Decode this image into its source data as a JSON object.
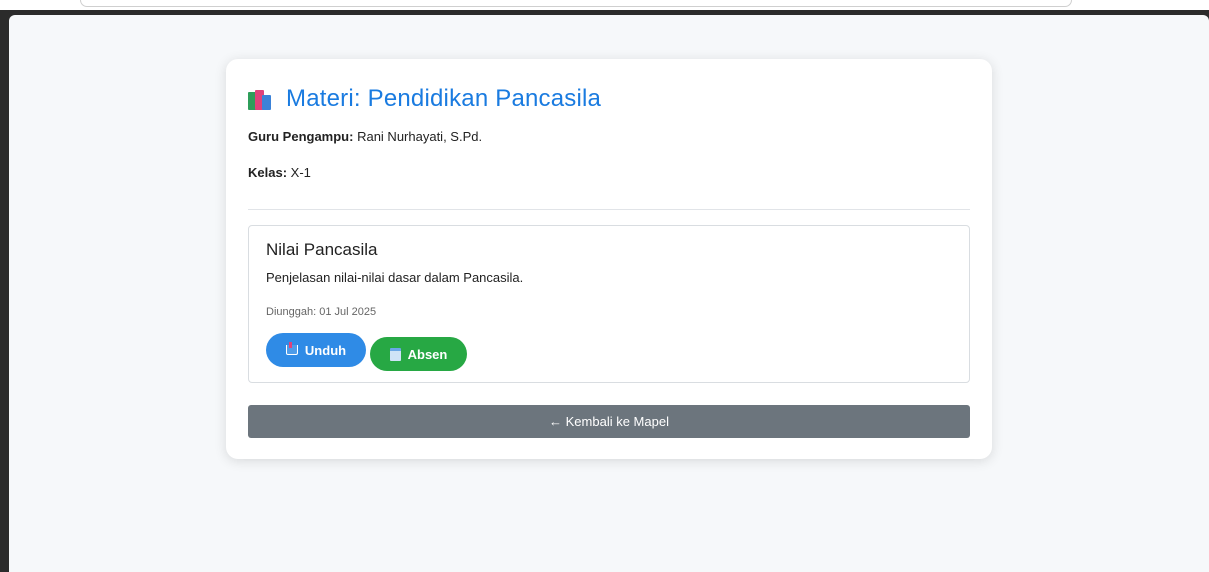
{
  "header": {
    "title": "Materi: Pendidikan Pancasila",
    "icon": "books-icon"
  },
  "info": {
    "teacher_label": "Guru Pengampu:",
    "teacher_value": "Rani Nurhayati, S.Pd.",
    "class_label": "Kelas:",
    "class_value": "X-1"
  },
  "material": {
    "title": "Nilai Pancasila",
    "description": "Penjelasan nilai-nilai dasar dalam Pancasila.",
    "uploaded": "Diunggah: 01 Jul 2025",
    "download_label": "Unduh",
    "attendance_label": "Absen"
  },
  "back_label": "← Kembali ke Mapel",
  "colors": {
    "title": "#1a7be0",
    "download_button": "#2f8be6",
    "attendance_button": "#27a844",
    "back_button": "#6c757d"
  }
}
